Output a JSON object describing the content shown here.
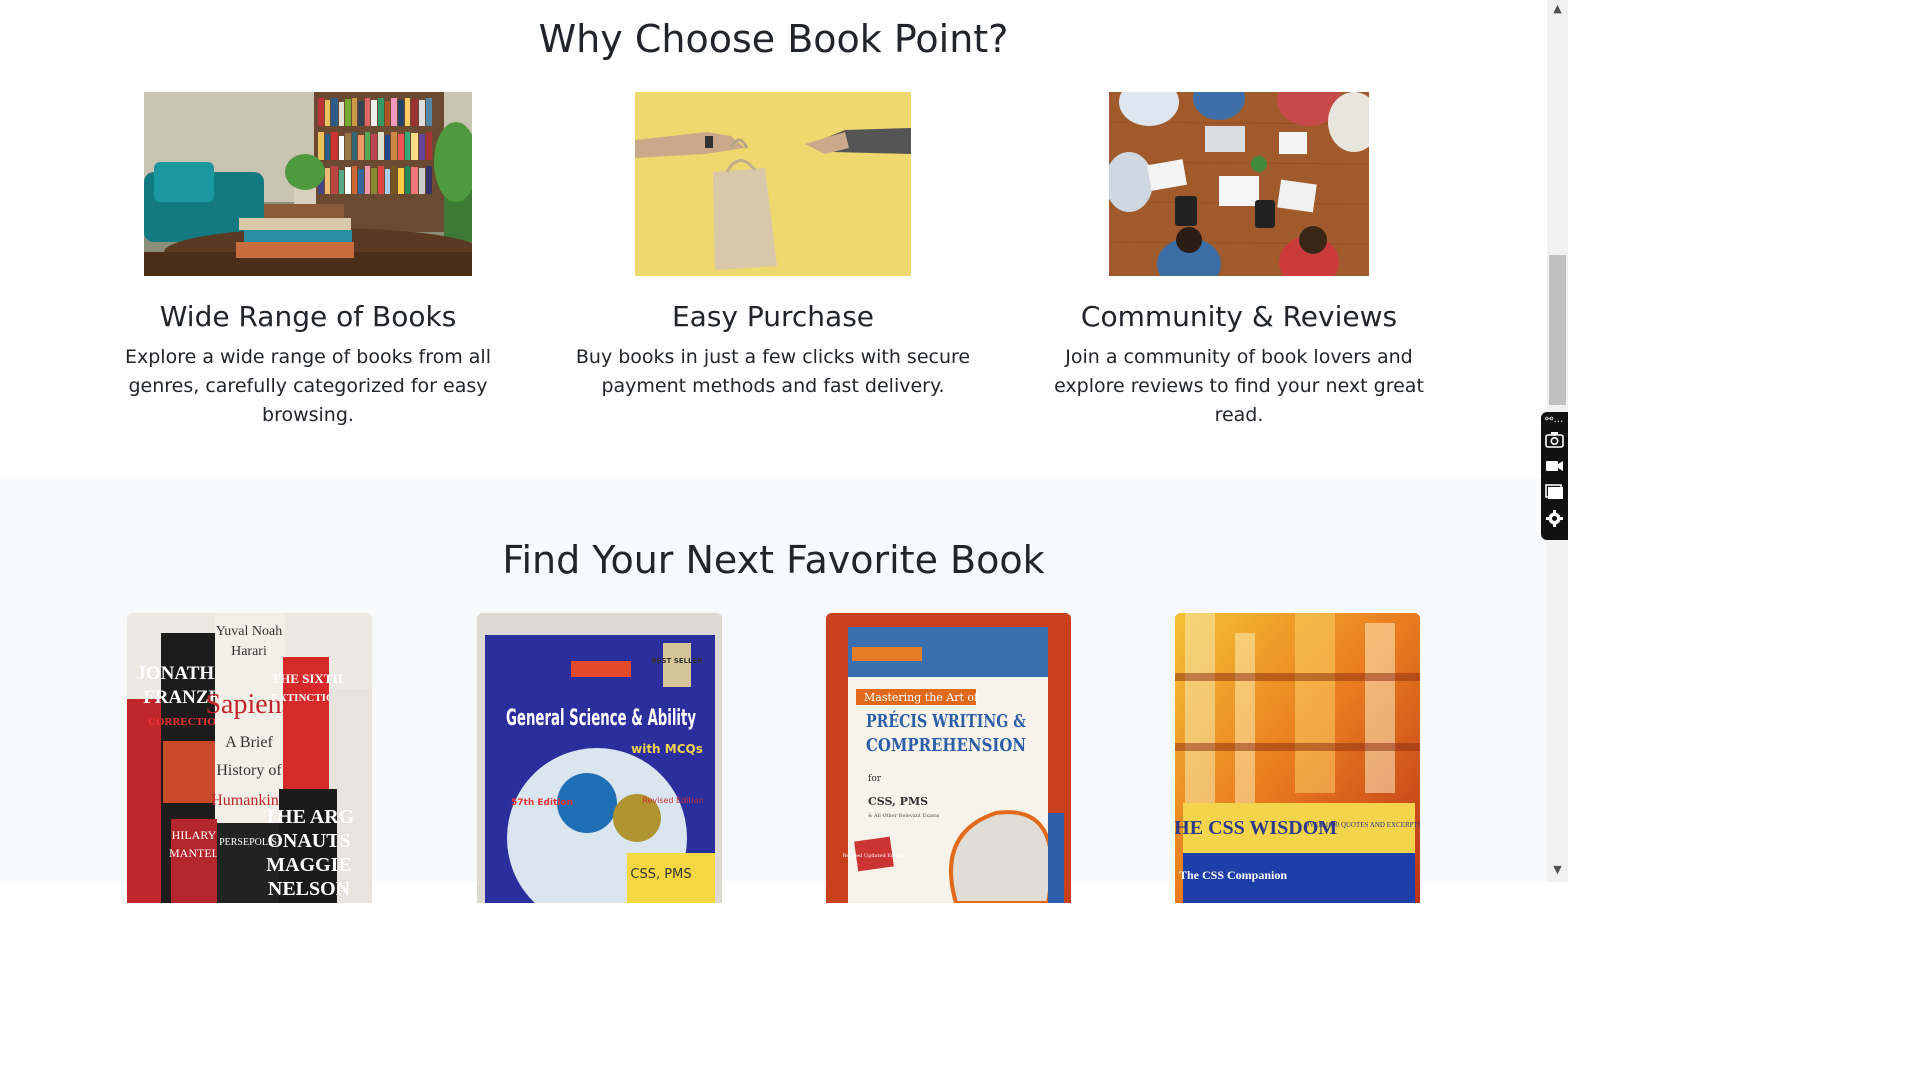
{
  "why_section": {
    "title": "Why Choose Book Point?",
    "features": [
      {
        "title": "Wide Range of Books",
        "description": "Explore a wide range of books from all genres, carefully categorized for easy browsing.",
        "image": "bookshelf-living-room-photo"
      },
      {
        "title": "Easy Purchase",
        "description": "Buy books in just a few clicks with secure payment methods and fast delivery.",
        "image": "shopping-bag-handover-photo"
      },
      {
        "title": "Community & Reviews",
        "description": "Join a community of book lovers and explore reviews to find your next great read.",
        "image": "people-at-table-photo"
      }
    ]
  },
  "find_section": {
    "title": "Find Your Next Favorite Book",
    "books": [
      {
        "cover": "bestseller-stack-cover",
        "texts": [
          "Yuval Noah",
          "Harari",
          "Sapiens",
          "A Brief",
          "History of",
          "Humankind",
          "JONATHAN",
          "FRANZEN",
          "CORRECTIONS",
          "THE SIXTH",
          "EXTINCTION",
          "HILARY",
          "MANTEL",
          "PERSEPOLIS",
          "THE ARG",
          "ONAUTS",
          "MAGGIE",
          "NELSON"
        ]
      },
      {
        "cover": "general-science-cover",
        "texts": [
          "General Science & Ability",
          "with MCQs",
          "BEST SELLER",
          "57th Edition",
          "Revised Edition",
          "CSS, PMS"
        ]
      },
      {
        "cover": "precis-writing-cover",
        "texts": [
          "Mastering the Art of",
          "PRÉCIS WRITING &",
          "COMPREHENSION",
          "for",
          "CSS, PMS",
          "& All Other Relevant Exams",
          "Revised Updated Edition"
        ]
      },
      {
        "cover": "css-wisdom-cover",
        "texts": [
          "THE CSS WISDOM",
          "OVER 1000 QUOTES AND EXCERPTS",
          "The CSS Companion"
        ]
      }
    ]
  },
  "colors": {
    "page_bg": "#ffffff",
    "alt_section_bg": "#f8f9fa",
    "text": "#212529"
  },
  "toolbar_icons": [
    "link-icon",
    "camera-icon",
    "video-icon",
    "window-icon",
    "gear-icon"
  ]
}
